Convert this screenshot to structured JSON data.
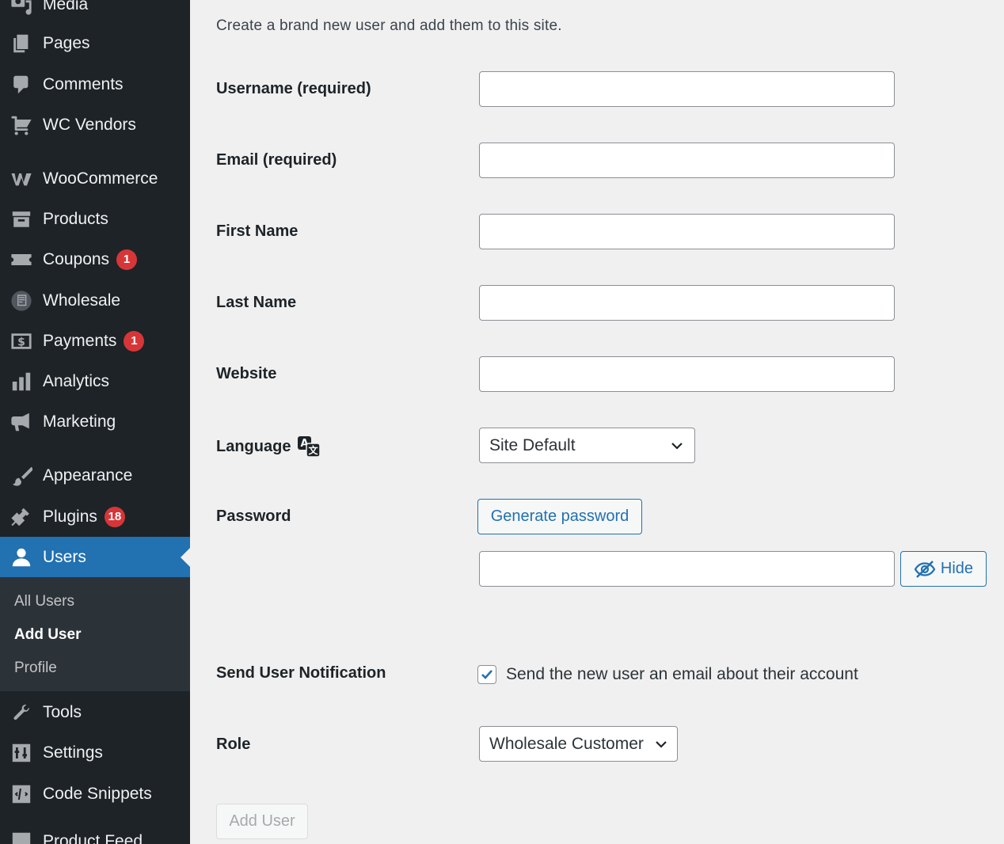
{
  "sidebar": {
    "items": [
      {
        "label": "Media",
        "icon": "media-icon"
      },
      {
        "label": "Pages",
        "icon": "pages-icon"
      },
      {
        "label": "Comments",
        "icon": "comments-icon"
      },
      {
        "label": "WC Vendors",
        "icon": "cart-icon"
      },
      {
        "label": "WooCommerce",
        "icon": "woocommerce-icon"
      },
      {
        "label": "Products",
        "icon": "archive-icon"
      },
      {
        "label": "Coupons",
        "icon": "ticket-icon",
        "badge": "1"
      },
      {
        "label": "Wholesale",
        "icon": "wholesale-icon"
      },
      {
        "label": "Payments",
        "icon": "payments-icon",
        "badge": "1"
      },
      {
        "label": "Analytics",
        "icon": "analytics-icon"
      },
      {
        "label": "Marketing",
        "icon": "megaphone-icon"
      },
      {
        "label": "Appearance",
        "icon": "paintbrush-icon"
      },
      {
        "label": "Plugins",
        "icon": "plugin-icon",
        "badge": "18"
      },
      {
        "label": "Users",
        "icon": "users-icon"
      },
      {
        "label": "Tools",
        "icon": "wrench-icon"
      },
      {
        "label": "Settings",
        "icon": "settings-icon"
      },
      {
        "label": "Code Snippets",
        "icon": "code-icon"
      },
      {
        "label": "Product Feed",
        "icon": "feed-icon"
      }
    ],
    "submenu": [
      "All Users",
      "Add User",
      "Profile"
    ]
  },
  "form": {
    "intro": "Create a brand new user and add them to this site.",
    "username_label": "Username (required)",
    "email_label": "Email (required)",
    "first_name_label": "First Name",
    "last_name_label": "Last Name",
    "website_label": "Website",
    "language_label": "Language",
    "language_value": "Site Default",
    "password_label": "Password",
    "generate_password": "Generate password",
    "hide_label": "Hide",
    "notification_label": "Send User Notification",
    "notification_text": "Send the new user an email about their account",
    "notification_checked": true,
    "role_label": "Role",
    "role_value": "Wholesale Customer",
    "submit_label": "Add User"
  },
  "colors": {
    "sidebar_bg": "#1d2327",
    "accent": "#2271b1",
    "badge": "#d63638",
    "page_bg": "#f0f0f1"
  }
}
